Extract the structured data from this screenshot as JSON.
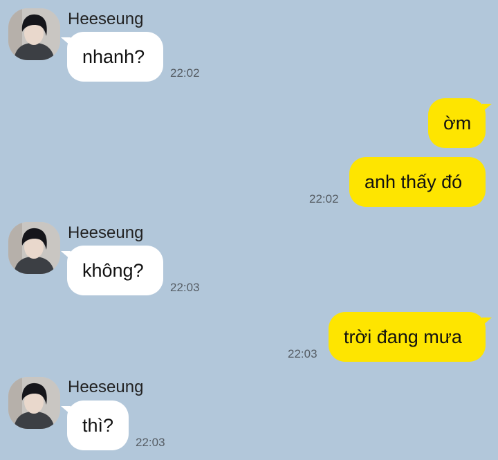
{
  "messages": [
    {
      "sender": "Heeseung",
      "text": "nhanh?",
      "time": "22:02"
    },
    {
      "text": "ờm"
    },
    {
      "text": "anh thấy đó",
      "time": "22:02"
    },
    {
      "sender": "Heeseung",
      "text": "không?",
      "time": "22:03"
    },
    {
      "text": "trời đang mưa",
      "time": "22:03"
    },
    {
      "sender": "Heeseung",
      "text": "thì?",
      "time": "22:03"
    }
  ],
  "colors": {
    "background": "#b2c7da",
    "incoming_bubble": "#ffffff",
    "outgoing_bubble": "#fee500"
  },
  "icons": {
    "avatar": "profile-photo-avatar"
  }
}
